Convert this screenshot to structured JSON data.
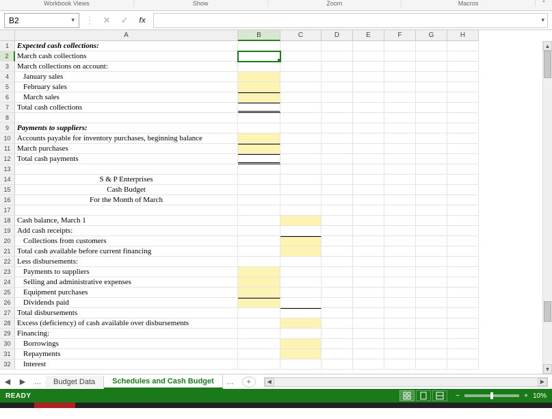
{
  "ribbon_groups": {
    "g1": "Workbook Views",
    "g2": "Show",
    "g3": "Zoom",
    "g4": "Macros"
  },
  "namebox": "B2",
  "formula": "",
  "columns": [
    "A",
    "B",
    "C",
    "D",
    "E",
    "F",
    "G",
    "H"
  ],
  "selected_col": "B",
  "selected_row": 2,
  "rows": [
    {
      "n": 1,
      "a": "Expected cash collections:",
      "cls": "bold-it"
    },
    {
      "n": 2,
      "a": "March cash collections",
      "selB": true
    },
    {
      "n": 3,
      "a": "March collections on account:"
    },
    {
      "n": 4,
      "a": "January sales",
      "cls": "indent",
      "hlB": true
    },
    {
      "n": 5,
      "a": "February sales",
      "cls": "indent",
      "hlB": true
    },
    {
      "n": 6,
      "a": "March sales",
      "cls": "indent",
      "hlB": true,
      "totB": true
    },
    {
      "n": 7,
      "a": "Total cash collections",
      "dblB": true
    },
    {
      "n": 8,
      "a": ""
    },
    {
      "n": 9,
      "a": "Payments to suppliers:",
      "cls": "bold-it"
    },
    {
      "n": 10,
      "a": "Accounts payable for inventory purchases, beginning balance",
      "hlB": true
    },
    {
      "n": 11,
      "a": "March purchases",
      "hlB": true,
      "totB": true
    },
    {
      "n": 12,
      "a": "Total cash payments",
      "dblB": true
    },
    {
      "n": 13,
      "a": ""
    },
    {
      "n": 14,
      "a": "S & P Enterprises",
      "cls": "center"
    },
    {
      "n": 15,
      "a": "Cash Budget",
      "cls": "center"
    },
    {
      "n": 16,
      "a": "For the Month of March",
      "cls": "center"
    },
    {
      "n": 17,
      "a": ""
    },
    {
      "n": 18,
      "a": "Cash balance, March 1",
      "hlC": true
    },
    {
      "n": 19,
      "a": "Add cash receipts:"
    },
    {
      "n": 20,
      "a": "Collections from customers",
      "cls": "indent",
      "hlC": true,
      "totC": true
    },
    {
      "n": 21,
      "a": "Total cash available before current financing",
      "hlC": true
    },
    {
      "n": 22,
      "a": "Less disbursements:"
    },
    {
      "n": 23,
      "a": "Payments to suppliers",
      "cls": "indent",
      "hlB": true
    },
    {
      "n": 24,
      "a": "Selling and administrative expenses",
      "cls": "indent",
      "hlB": true
    },
    {
      "n": 25,
      "a": "Equipment purchases",
      "cls": "indent",
      "hlB": true
    },
    {
      "n": 26,
      "a": "Dividends paid",
      "cls": "indent",
      "hlB": true,
      "totB": true
    },
    {
      "n": 27,
      "a": "Total disbursements",
      "totC": true
    },
    {
      "n": 28,
      "a": "Excess (deficiency) of cash available over disbursements",
      "hlC": true
    },
    {
      "n": 29,
      "a": "Financing:"
    },
    {
      "n": 30,
      "a": "Borrowings",
      "cls": "indent",
      "hlC": true
    },
    {
      "n": 31,
      "a": "Repayments",
      "cls": "indent",
      "hlC": true
    },
    {
      "n": 32,
      "a": "Interest",
      "cls": "indent"
    }
  ],
  "tabs": {
    "t1": "Budget Data",
    "t2": "Schedules and Cash Budget"
  },
  "status": {
    "ready": "READY",
    "zoom": "10%"
  }
}
